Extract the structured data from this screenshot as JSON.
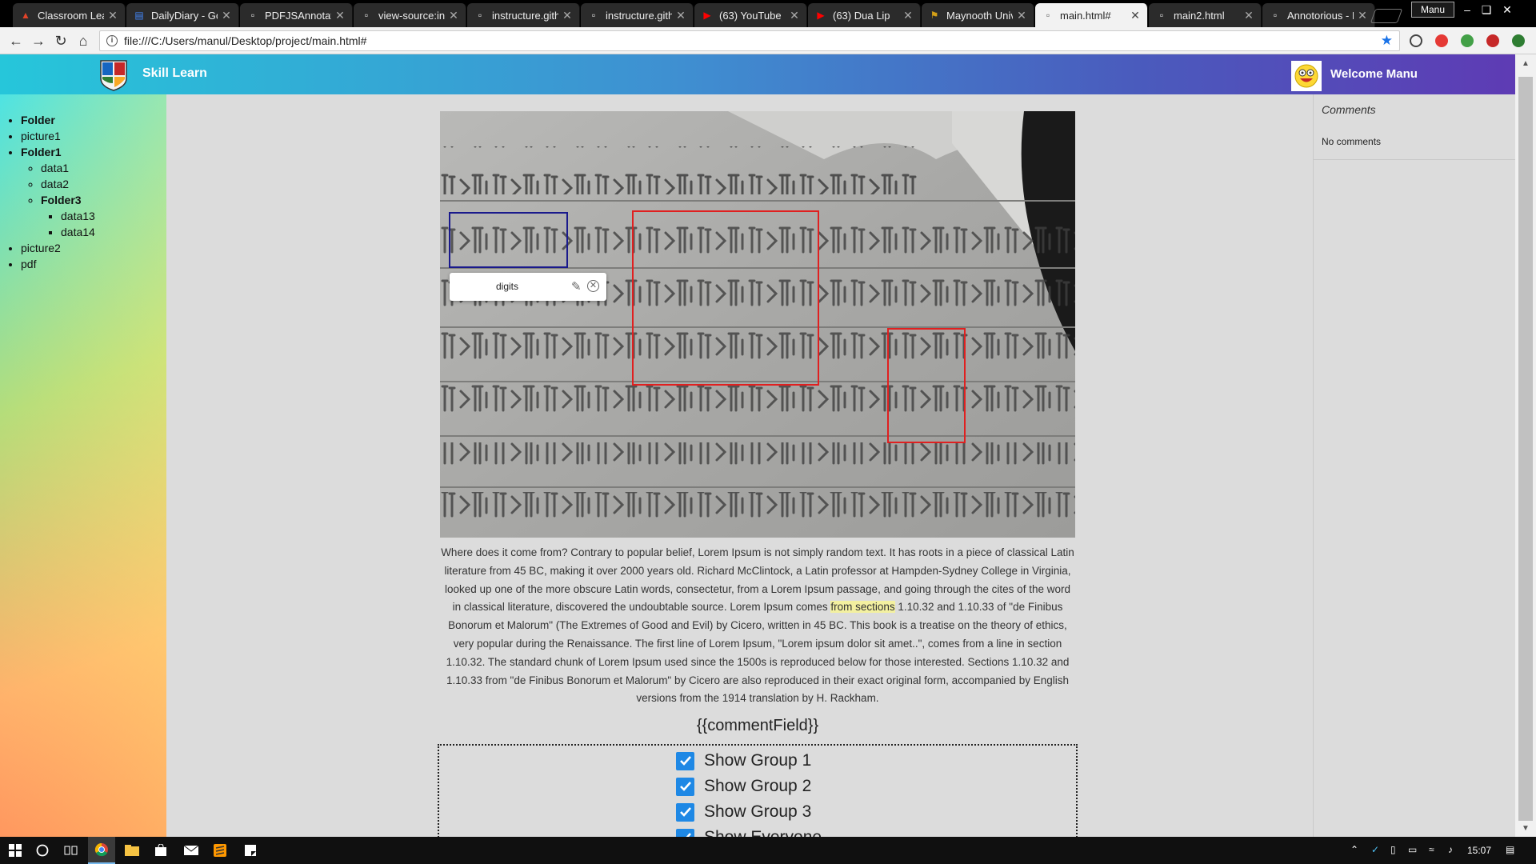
{
  "browser": {
    "tabs": [
      {
        "title": "Classroom Lear",
        "icon": "gitlab-icon",
        "color": "#e24329"
      },
      {
        "title": "DailyDiary - Go",
        "icon": "google-docs-icon",
        "color": "#4285f4"
      },
      {
        "title": "PDFJSAnnotate",
        "icon": "page-icon",
        "color": "#eeeeee"
      },
      {
        "title": "view-source:ins",
        "icon": "page-icon",
        "color": "#eeeeee"
      },
      {
        "title": "instructure.gith",
        "icon": "page-icon",
        "color": "#eeeeee"
      },
      {
        "title": "instructure.gith",
        "icon": "page-icon",
        "color": "#eeeeee"
      },
      {
        "title": "(63) YouTube",
        "icon": "youtube-icon",
        "color": "#ff0000"
      },
      {
        "title": "(63) Dua Lip",
        "icon": "youtube-icon",
        "color": "#ff0000"
      },
      {
        "title": "Maynooth Univ",
        "icon": "university-icon",
        "color": "#d4a017"
      },
      {
        "title": "main.html#",
        "icon": "page-icon",
        "color": "#555555",
        "active": true
      },
      {
        "title": "main2.html",
        "icon": "page-icon",
        "color": "#eeeeee"
      },
      {
        "title": "Annotorious - I",
        "icon": "page-icon",
        "color": "#eeeeee"
      }
    ],
    "profile": "Manu",
    "url": "file:///C:/Users/manul/Desktop/project/main.html#"
  },
  "app": {
    "brand": "Skill Learn",
    "welcome": "Welcome Manu",
    "brand_gradient": [
      "#26c6da",
      "#5e3bb4"
    ]
  },
  "tree": {
    "root": "Folder",
    "picture1": "picture1",
    "folder1": "Folder1",
    "data1": "data1",
    "data2": "data2",
    "folder3": "Folder3",
    "data13": "data13",
    "data14": "data14",
    "picture2": "picture2",
    "pdf": "pdf"
  },
  "annotation": {
    "label": "digits",
    "selected_color": "#1a1a8c",
    "box_color": "#e02020"
  },
  "article": {
    "before": "Where does it come from? Contrary to popular belief, Lorem Ipsum is not simply random text. It has roots in a piece of classical Latin literature from 45 BC, making it over 2000 years old. Richard McClintock, a Latin professor at Hampden-Sydney College in Virginia, looked up one of the more obscure Latin words, consectetur, from a Lorem Ipsum passage, and going through the cites of the word in classical literature, discovered the undoubtable source. Lorem Ipsum comes ",
    "highlight": "from sections",
    "after": " 1.10.32 and 1.10.33 of \"de Finibus Bonorum et Malorum\" (The Extremes of Good and Evil) by Cicero, written in 45 BC. This book is a treatise on the theory of ethics, very popular during the Renaissance. The first line of Lorem Ipsum, \"Lorem ipsum dolor sit amet..\", comes from a line in section 1.10.32. The standard chunk of Lorem Ipsum used since the 1500s is reproduced below for those interested. Sections 1.10.32 and 1.10.33 from \"de Finibus Bonorum et Malorum\" by Cicero are also reproduced in their exact original form, accompanied by English versions from the 1914 translation by H. Rackham."
  },
  "comment_field": "{{commentField}}",
  "groups": [
    {
      "label": "Show Group 1",
      "checked": true
    },
    {
      "label": "Show Group 2",
      "checked": true
    },
    {
      "label": "Show Group 3",
      "checked": true
    },
    {
      "label": "Show Everyone",
      "checked": true
    }
  ],
  "comments": {
    "title": "Comments",
    "empty": "No comments"
  },
  "taskbar": {
    "clock": "15:07"
  }
}
